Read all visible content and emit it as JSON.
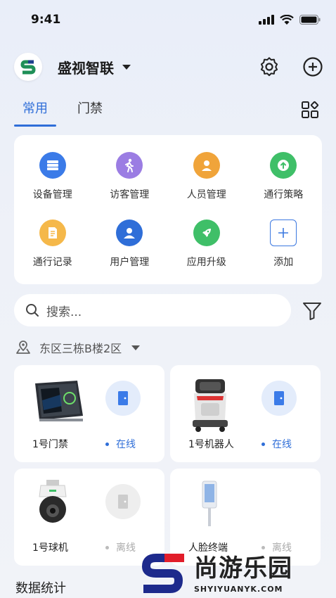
{
  "status_bar": {
    "time": "9:41"
  },
  "header": {
    "org_name": "盛视智联"
  },
  "tabs": [
    {
      "label": "常用",
      "active": true
    },
    {
      "label": "门禁",
      "active": false
    }
  ],
  "quick_actions": [
    {
      "label": "设备管理",
      "icon": "server-icon",
      "color": "#3b7be8"
    },
    {
      "label": "访客管理",
      "icon": "walker-icon",
      "color": "#9b7de3"
    },
    {
      "label": "人员管理",
      "icon": "person-icon",
      "color": "#f0a43a"
    },
    {
      "label": "通行策略",
      "icon": "arrow-up-icon",
      "color": "#3fbf68"
    },
    {
      "label": "通行记录",
      "icon": "document-icon",
      "color": "#f5b84a"
    },
    {
      "label": "用户管理",
      "icon": "user-icon",
      "color": "#2f6ed8"
    },
    {
      "label": "应用升级",
      "icon": "rocket-icon",
      "color": "#3fbf68"
    },
    {
      "label": "添加",
      "icon": "plus-icon",
      "color": "#3b78e0"
    }
  ],
  "search": {
    "placeholder": "搜索..."
  },
  "location": {
    "label": "东区三栋B楼2区"
  },
  "devices": [
    {
      "name": "1号门禁",
      "status": "在线",
      "online": true
    },
    {
      "name": "1号机器人",
      "status": "在线",
      "online": true
    },
    {
      "name": "1号球机",
      "status": "离线",
      "online": false
    },
    {
      "name": "人脸终端",
      "status": "离线",
      "online": false
    }
  ],
  "colors": {
    "accent": "#2f6ed8",
    "online": "#2f6ed8",
    "offline": "#aaaaaa"
  },
  "section": {
    "title": "数据统计"
  },
  "watermark": {
    "brand": "尚游乐园",
    "url": "SHYIYUANYK.COM"
  }
}
